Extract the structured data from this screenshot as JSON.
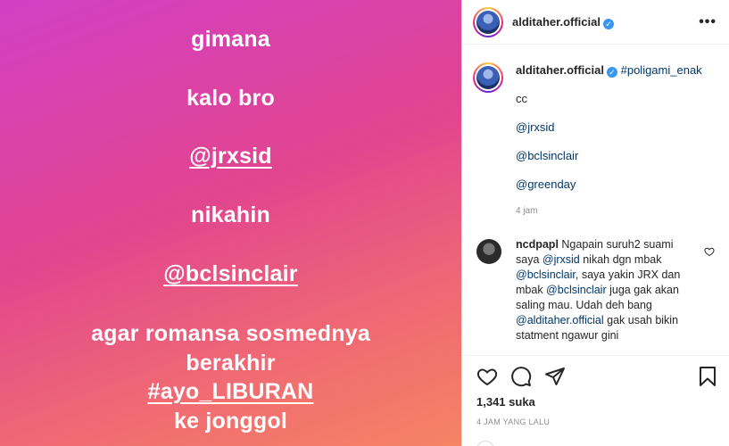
{
  "post_image": {
    "lines": [
      "gimana",
      "kalo bro",
      "@jrxsid",
      "nikahin",
      "@bclsinclair",
      "agar romansa sosmednya",
      "berakhir",
      "#ayo_LIBURAN",
      "ke jonggol"
    ]
  },
  "header": {
    "username": "alditaher.official",
    "more": "•••"
  },
  "caption": {
    "username": "alditaher.official",
    "hashtag": "#poligami_enak",
    "lines": [
      "cc",
      "@jrxsid",
      "@bclsinclair",
      "@greenday"
    ],
    "time": "4 jam"
  },
  "comment": {
    "username": "ncdpapl",
    "segments": [
      {
        "t": "Ngapain suruh2 suami saya ",
        "k": "text"
      },
      {
        "t": "@jrxsid",
        "k": "mention"
      },
      {
        "t": " nikah dgn mbak ",
        "k": "text"
      },
      {
        "t": "@bclsinclair",
        "k": "mention"
      },
      {
        "t": ", saya yakin JRX dan mbak ",
        "k": "text"
      },
      {
        "t": "@bclsinclair",
        "k": "mention"
      },
      {
        "t": " juga gak akan saling mau. Udah deh bang ",
        "k": "text"
      },
      {
        "t": "@alditaher.official",
        "k": "mention"
      },
      {
        "t": " gak usah bikin statment ngawur gini",
        "k": "text"
      }
    ]
  },
  "likes": "1,341 suka",
  "time_ago": "4 JAM YANG LALU",
  "icons": {
    "like": "heart-icon",
    "comment": "comment-icon",
    "share": "share-icon",
    "save": "bookmark-icon"
  },
  "colors": {
    "link": "#00376b",
    "verified": "#3897f0"
  }
}
